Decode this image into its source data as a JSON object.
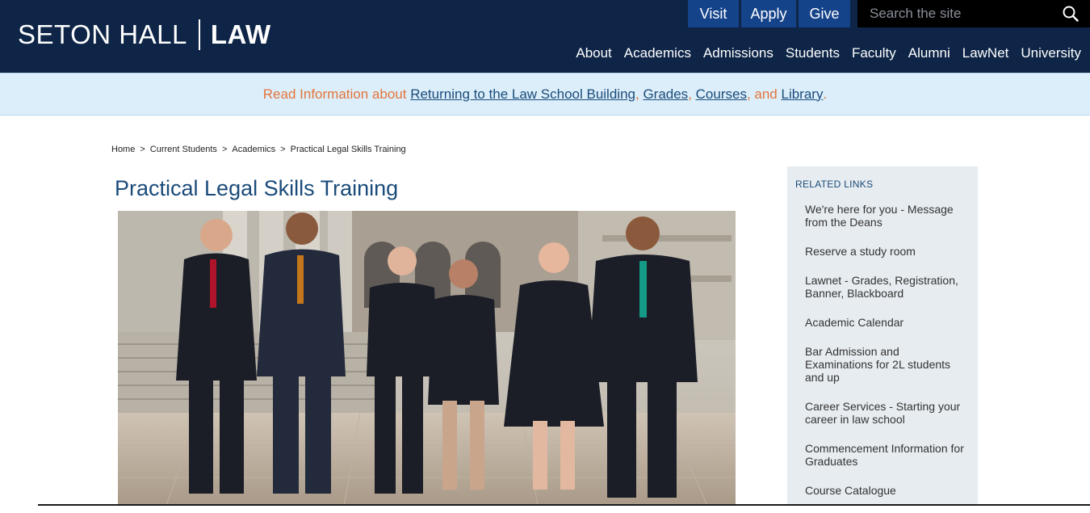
{
  "header": {
    "logo_school": "SETON HALL",
    "logo_law": "LAW",
    "top_buttons": [
      "Visit",
      "Apply",
      "Give"
    ],
    "search_placeholder": "Search the site",
    "nav": [
      "About",
      "Academics",
      "Admissions",
      "Students",
      "Faculty",
      "Alumni",
      "LawNet",
      "University"
    ]
  },
  "alert": {
    "prefix": "Read Information about ",
    "link1": "Returning to the Law School Building",
    "sep1": ", ",
    "link2": "Grades",
    "sep2": ", ",
    "link3": "Courses",
    "sep3": ", and ",
    "link4": "Library",
    "suffix": "."
  },
  "breadcrumb": [
    "Home",
    "Current Students",
    "Academics",
    "Practical Legal Skills Training"
  ],
  "page_title": "Practical Legal Skills Training",
  "related": {
    "heading": "RELATED LINKS",
    "links": [
      "We're here for you - Message from the Deans",
      "Reserve a study room",
      "Lawnet - Grades, Registration, Banner, Blackboard",
      "Academic Calendar",
      "Bar Admission and Examinations for 2L students and up",
      "Career Services - Starting your career in law school",
      "Commencement Information for Graduates",
      "Course Catalogue"
    ]
  },
  "colors": {
    "header_bg": "#0e2547",
    "button_bg": "#15438a",
    "alert_bg": "#dceefa",
    "alert_orange": "#e4743a",
    "link_blue": "#1a4b7a",
    "sidebar_bg": "#e7ecf0"
  }
}
